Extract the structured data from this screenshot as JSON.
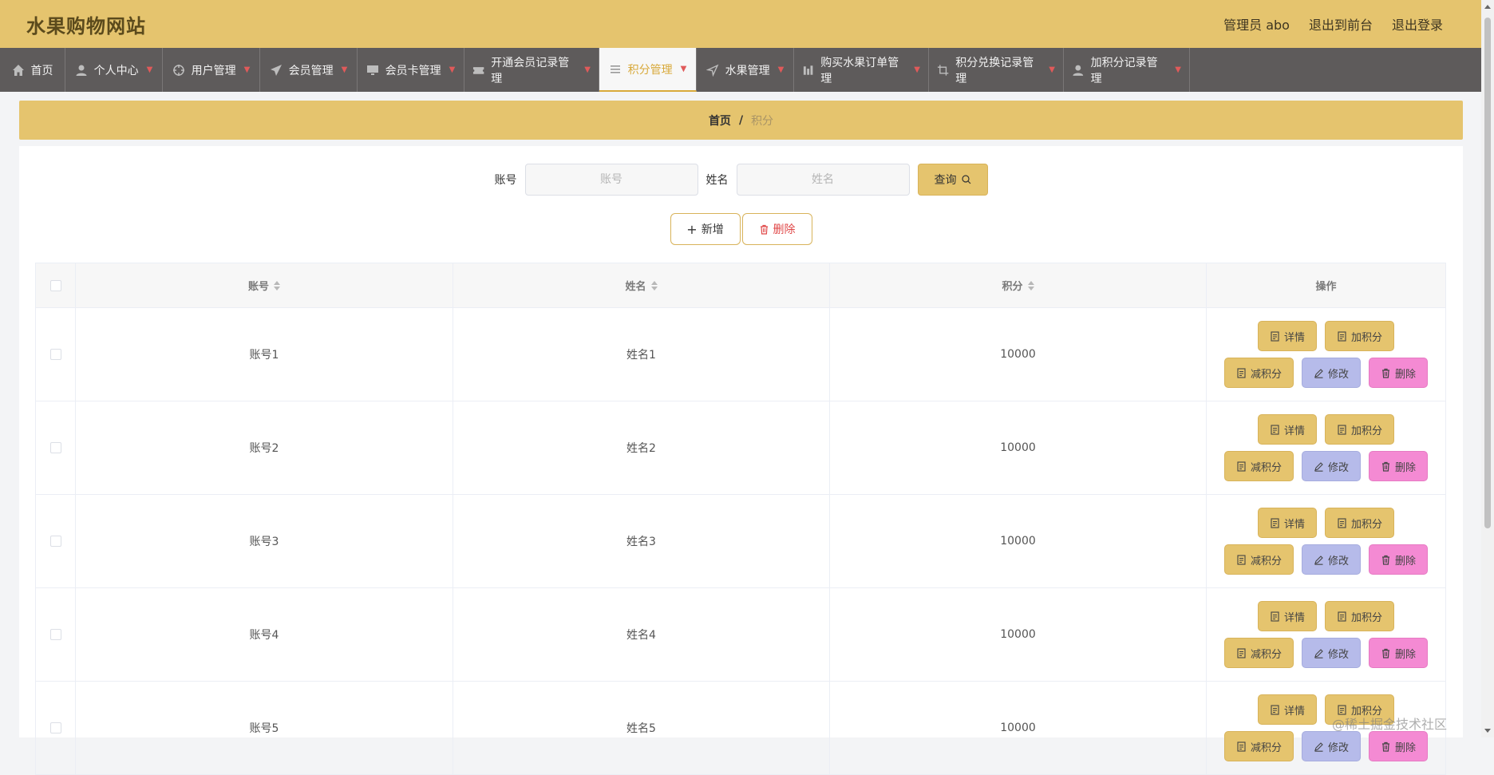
{
  "header": {
    "title": "水果购物网站",
    "admin_label": "管理员 abo",
    "to_front_label": "退出到前台",
    "logout_label": "退出登录"
  },
  "nav": [
    {
      "label": "首页",
      "icon": "home-icon",
      "dropdown": false
    },
    {
      "label": "个人中心",
      "icon": "user-icon",
      "dropdown": true
    },
    {
      "label": "用户管理",
      "icon": "crosshair-icon",
      "dropdown": true
    },
    {
      "label": "会员管理",
      "icon": "send-icon",
      "dropdown": true
    },
    {
      "label": "会员卡管理",
      "icon": "monitor-icon",
      "dropdown": true
    },
    {
      "label": "开通会员记录管理",
      "icon": "ticket-icon",
      "dropdown": true
    },
    {
      "label": "积分管理",
      "icon": "list-icon",
      "dropdown": true,
      "active": true
    },
    {
      "label": "水果管理",
      "icon": "navigation-icon",
      "dropdown": true
    },
    {
      "label": "购买水果订单管理",
      "icon": "chart-icon",
      "dropdown": true
    },
    {
      "label": "积分兑换记录管理",
      "icon": "crop-icon",
      "dropdown": true
    },
    {
      "label": "加积分记录管理",
      "icon": "user-icon",
      "dropdown": true
    }
  ],
  "breadcrumb": {
    "home": "首页",
    "separator": "/",
    "current": "积分"
  },
  "search": {
    "account_label": "账号",
    "account_placeholder": "账号",
    "name_label": "姓名",
    "name_placeholder": "姓名",
    "query_label": "查询"
  },
  "actions": {
    "add_label": "新增",
    "delete_label": "删除"
  },
  "table": {
    "headers": {
      "account": "账号",
      "name": "姓名",
      "points": "积分",
      "ops": "操作"
    },
    "ops_labels": {
      "detail": "详情",
      "add_points": "加积分",
      "reduce_points": "减积分",
      "edit": "修改",
      "delete": "删除"
    },
    "rows": [
      {
        "account": "账号1",
        "name": "姓名1",
        "points": "10000"
      },
      {
        "account": "账号2",
        "name": "姓名2",
        "points": "10000"
      },
      {
        "account": "账号3",
        "name": "姓名3",
        "points": "10000"
      },
      {
        "account": "账号4",
        "name": "姓名4",
        "points": "10000"
      },
      {
        "account": "账号5",
        "name": "姓名5",
        "points": "10000"
      }
    ]
  },
  "watermark": "@稀土掘金技术社区",
  "colors": {
    "accent": "#e5c46e",
    "nav_bg": "#5e5b5b",
    "edit_btn": "#b6bbea",
    "delete_btn": "#f48ad3",
    "active_nav_text": "#d8a93a"
  }
}
